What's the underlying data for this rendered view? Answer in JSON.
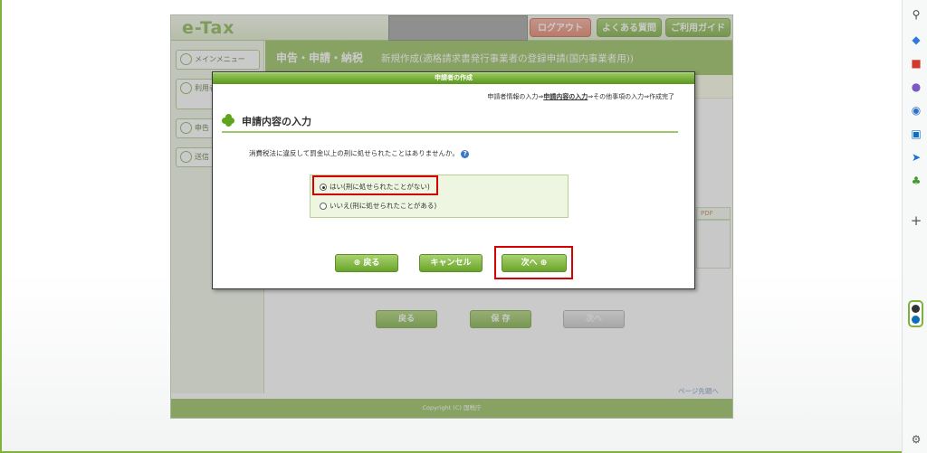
{
  "site": {
    "logo": "e-Tax",
    "header": {
      "logout_label": "ログアウト",
      "faq_label": "よくある質問",
      "guide_label": "ご利用ガイド"
    },
    "nav": [
      {
        "label": "メインメニュー"
      },
      {
        "label": "利用者情報"
      },
      {
        "label": "申告"
      },
      {
        "label": "送信"
      }
    ],
    "band": {
      "title": "申告・申請・納税",
      "subtitle": "新規作成(適格請求書発行事業者の登録申請(国内事業者用))"
    },
    "background_tab": "PDF",
    "background_buttons": {
      "back": "戻る",
      "save": "保 存",
      "next": "次へ"
    },
    "page_top": "ページ先頭へ",
    "footer": "Copyright (C) 国税庁"
  },
  "modal": {
    "title": "申請者の作成",
    "steps": {
      "step1": "申請者情報の入力",
      "step2": "申請内容の入力",
      "step3": "その他事項の入力",
      "step4": "作成完了",
      "arrow": "⇒"
    },
    "section_title": "申請内容の入力",
    "question": "消費税法に違反して罰金以上の刑に処せられたことはありませんか。",
    "options": [
      {
        "label": "はい(刑に処せられたことがない)",
        "selected": true
      },
      {
        "label": "いいえ(刑に処せられたことがある)",
        "selected": false
      }
    ],
    "buttons": {
      "back": "戻る",
      "cancel": "キャンセル",
      "next": "次へ"
    }
  },
  "colors": {
    "accent_green": "#8cbb4f",
    "highlight_red": "#d60000"
  },
  "icons": {
    "sidebar": [
      "search-icon",
      "tag-icon",
      "toolbox-icon",
      "people-icon",
      "copilot-icon",
      "outlook-icon",
      "paper-plane-icon",
      "tree-icon"
    ]
  }
}
